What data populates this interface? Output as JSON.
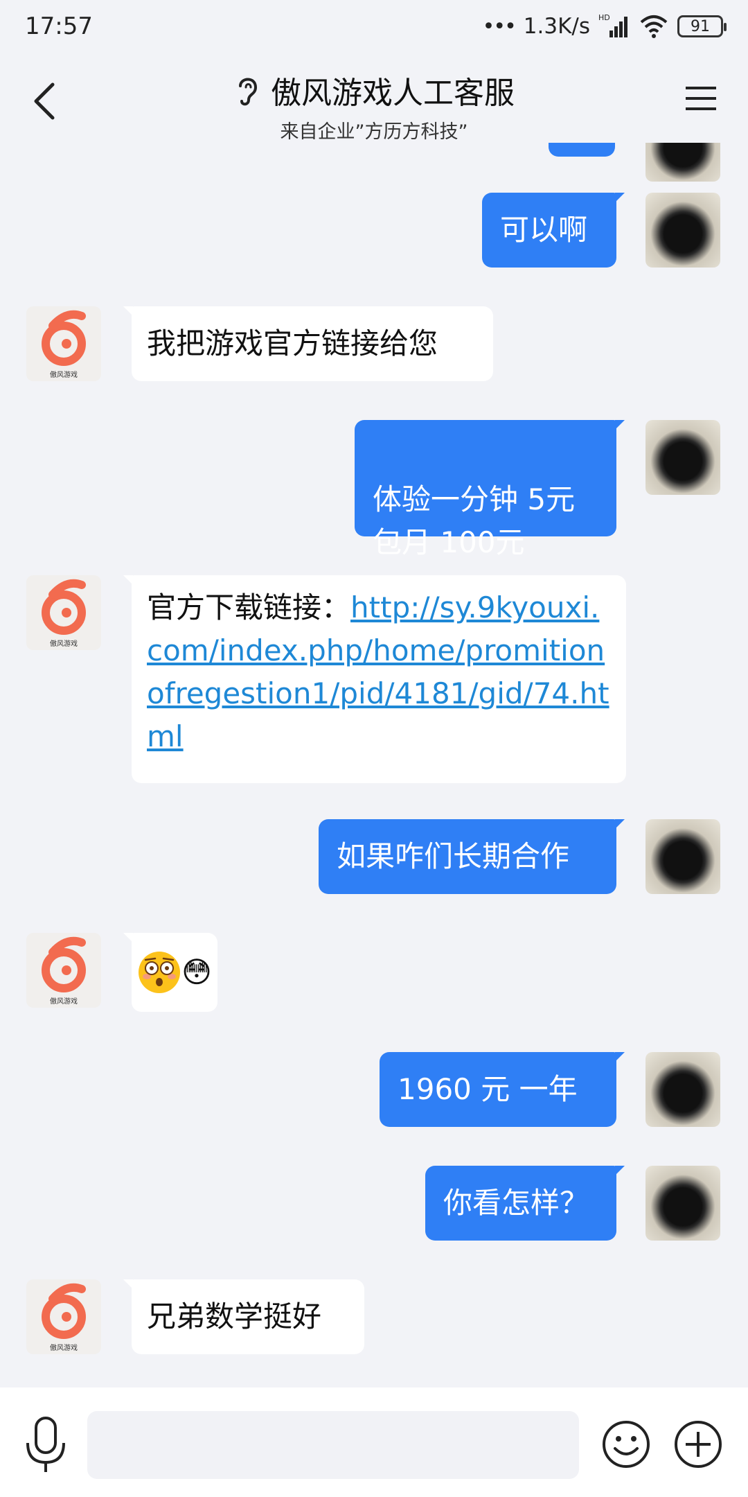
{
  "status": {
    "time": "17:57",
    "dots": "•••",
    "speed": "1.3K/s",
    "hd": "HD",
    "battery": "91"
  },
  "header": {
    "title": "傲风游戏人工客服",
    "subtitle": "来自企业”方历方科技”"
  },
  "avatar_logo_text": "傲风游戏",
  "messages": [
    {
      "from": "me",
      "text": "可以啊"
    },
    {
      "from": "them",
      "text": "我把游戏官方链接给您"
    },
    {
      "from": "me",
      "text": "体验一分钟 5元\n包月  100元"
    },
    {
      "from": "them",
      "prefix": "官方下载链接：",
      "link": "http://sy.9kyouxi.com/index.php/home/promitionofregestion1/pid/4181/gid/74.html"
    },
    {
      "from": "me",
      "text": "如果咋们长期合作"
    },
    {
      "from": "them",
      "emoji": "😳"
    },
    {
      "from": "me",
      "text": "1960 元  一年"
    },
    {
      "from": "me",
      "text": "你看怎样？"
    },
    {
      "from": "them",
      "text": "兄弟数学挺好"
    }
  ],
  "input": {
    "placeholder": ""
  },
  "icons": {
    "back": "back-chevron-icon",
    "ear": "ear-icon",
    "menu": "menu-icon",
    "mic": "microphone-icon",
    "emoji": "emoji-icon",
    "plus": "plus-icon"
  },
  "colors": {
    "my_bubble": "#2f7ff5",
    "their_bubble": "#ffffff",
    "link": "#1e88d6",
    "background": "#f2f3f7",
    "logo": "#f26b4f"
  }
}
